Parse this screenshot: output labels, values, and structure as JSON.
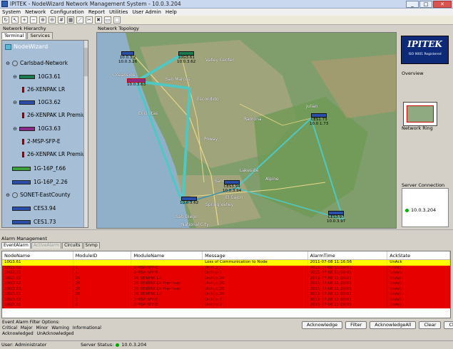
{
  "window": {
    "title": "IPITEK - NodeWizard Network Management System - 10.0.3.204",
    "min": "_",
    "max": "□",
    "close": "✕"
  },
  "menu": [
    "System",
    "Network",
    "Configuration",
    "Report",
    "Utilities",
    "User Admin",
    "Help"
  ],
  "left": {
    "header": "Network Hierarchy",
    "tabs": [
      "Terminal",
      "Services"
    ],
    "root": "NodeWizard",
    "items": [
      {
        "label": "Carlsbad-Network",
        "kind": "network"
      },
      {
        "label": "10G3.61",
        "kind": "device"
      },
      {
        "label": "26-XENPAK LR",
        "kind": "card"
      },
      {
        "label": "10G3.62",
        "kind": "device"
      },
      {
        "label": "26-XENPAK LR Premium",
        "kind": "card"
      },
      {
        "label": "10G3.63",
        "kind": "device"
      },
      {
        "label": "2-MSP-SFP-E",
        "kind": "card"
      },
      {
        "label": "26-XENPAK LR Premium",
        "kind": "card"
      },
      {
        "label": "1G-16P_f.66",
        "kind": "device"
      },
      {
        "label": "1G-16P_2.26",
        "kind": "device"
      },
      {
        "label": "SONET-EastCounty",
        "kind": "network"
      },
      {
        "label": "CES3.94",
        "kind": "device"
      },
      {
        "label": "CES1.73",
        "kind": "device"
      }
    ]
  },
  "map": {
    "header": "Network Topology",
    "places": [
      {
        "name": "Oceanside"
      },
      {
        "name": "Valley Center"
      },
      {
        "name": "San Marcos"
      },
      {
        "name": "Escondido"
      },
      {
        "name": "Poway"
      },
      {
        "name": "Ramona"
      },
      {
        "name": "Santee"
      },
      {
        "name": "El Cajon"
      },
      {
        "name": "Alpine"
      },
      {
        "name": "Julian"
      },
      {
        "name": "San Diego"
      },
      {
        "name": "Lakeside"
      },
      {
        "name": "Encinitas"
      },
      {
        "name": "Spring Valley"
      },
      {
        "name": "National City"
      }
    ],
    "nodes": [
      {
        "name": "10.0.3.2",
        "label2": "10.0.3.26"
      },
      {
        "name": "10G3.61",
        "label2": "10.0.3.62"
      },
      {
        "name": "10G3.63",
        "label2": "10.0.3.63"
      },
      {
        "name": "CES1.73",
        "label2": "10.0.1.73"
      },
      {
        "name": "CES3.94",
        "label2": "10.0.3.94"
      },
      {
        "name": "CES3.97",
        "label2": "10.0.3.97"
      },
      {
        "name": "10.0.3.62",
        "label2": ""
      }
    ]
  },
  "right": {
    "logo_name": "IPITEK",
    "logo_sub": "ISO 9001 Registered",
    "overview": "Overview",
    "ring": "Network Ring",
    "server_connection": "Server Connection",
    "server_ip": "10.0.3.204"
  },
  "alarms": {
    "header": "Alarm Management",
    "tabs": [
      "EventAlarm",
      "ActiveAlarm",
      "Circuits",
      "Snmp"
    ],
    "columns": [
      "NodeName",
      "ModuleID",
      "ModuleName",
      "Message",
      "AlarmTime",
      "AckState"
    ],
    "rows": [
      [
        "10G3.61",
        "",
        "",
        "Loss of Communication to Node",
        "2011-07-08 11:16:56",
        "UnAck"
      ],
      [
        "10G3.62",
        "1",
        "2-MSP-SFP-E",
        "UnitUp 1",
        "2011-07-08 11:09:01",
        "UnAck"
      ],
      [
        "10G3.61",
        "1",
        "2-MSP-SFP-E",
        "UnitUp 1",
        "2011-07-08 11:09:01",
        "UnAck"
      ],
      [
        "10G3.61",
        "26",
        "26-XENPAK LR",
        "UnitUp 26",
        "2011-07-08 11:09:01",
        "UnAck"
      ],
      [
        "10G3.62",
        "26",
        "26-XENPAK LR Premium",
        "UnitUp 26",
        "2011-07-08 11:09:01",
        "UnAck"
      ],
      [
        "10G3.63",
        "26",
        "26-XENPAK LR Premium",
        "UnitUp 26",
        "2011-07-08 11:09:01",
        "UnAck"
      ],
      [
        "10G3.61",
        "26",
        "26-XENPAK LR",
        "UnitUp 26",
        "2011-07-08 11:09:01",
        "UnAck"
      ],
      [
        "10G3.62",
        "2",
        "2-MSP-SFP-E",
        "UnitUp 2",
        "2011-07-08 11:09:01",
        "UnAck"
      ],
      [
        "10G3.61",
        "2",
        "2-MSP-SFP-E",
        "UnitUp 2",
        "2011-07-08 11:09:01",
        "UnAck"
      ]
    ]
  },
  "filter": {
    "title": "Event Alarm Filter Options:",
    "options": [
      "Critical",
      "Major",
      "Minor",
      "Warning",
      "Informational"
    ],
    "options2": [
      "Acknowledged",
      "UnAcknowledged"
    ]
  },
  "buttons": [
    "Acknowledge",
    "Filter",
    "AcknowledgeAll",
    "Clear",
    "ClearAll"
  ],
  "status": {
    "user": "User: Administrator",
    "server_label": "Server Status:",
    "server_ip": "10.0.3.204"
  },
  "colors": {
    "alarm_red": "#e60000",
    "alarm_yellow": "#ffff00",
    "link_cyan": "#4fc7c2",
    "tree_bg": "#a7bfd6"
  }
}
